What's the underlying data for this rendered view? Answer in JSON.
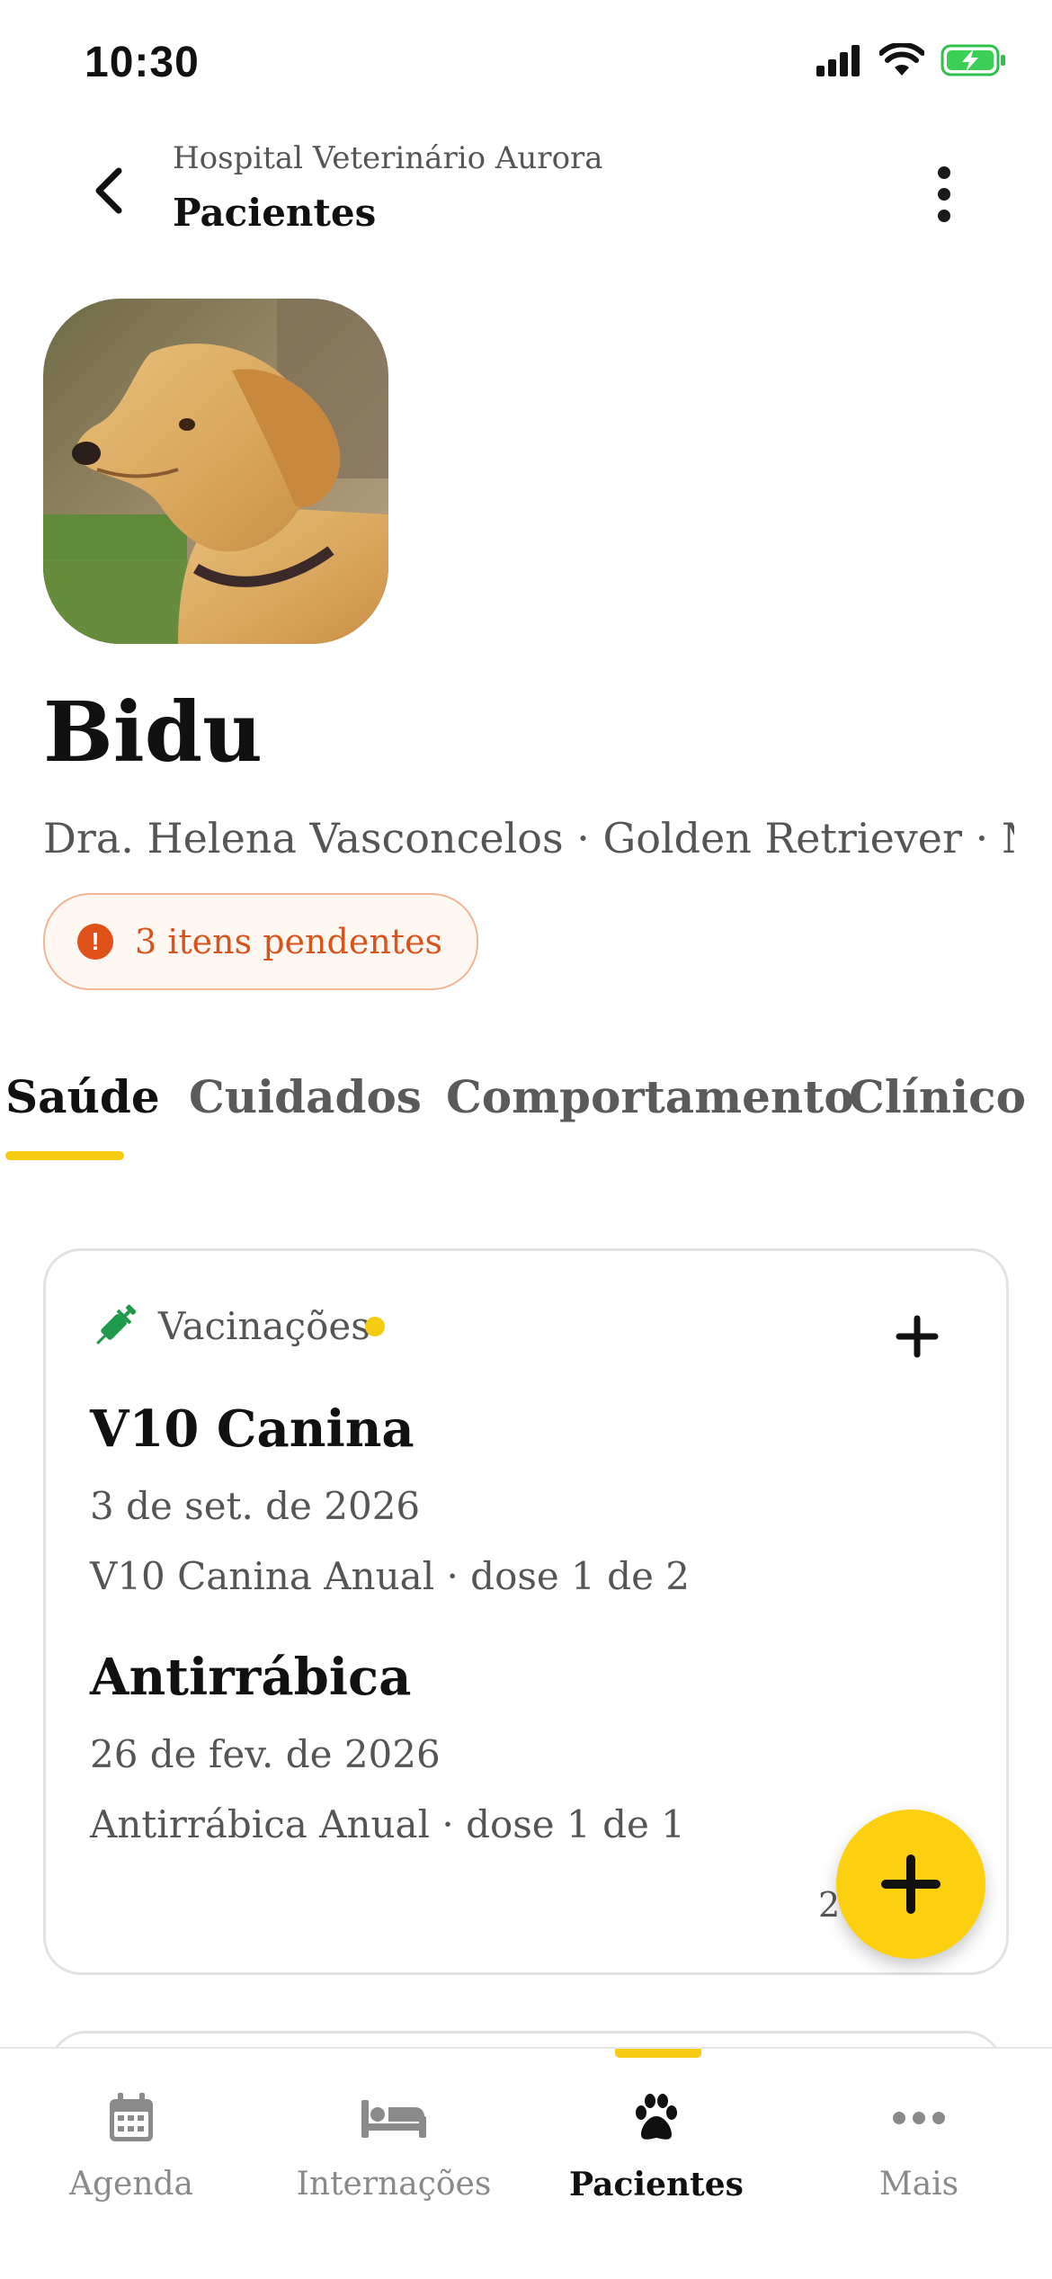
{
  "status_bar": {
    "time": "10:30"
  },
  "header": {
    "subtitle": "Hospital Veterinário Aurora",
    "title": "Pacientes"
  },
  "patient": {
    "name": "Bidu",
    "meta": "Dra. Helena Vasconcelos · Golden Retriever · Ma...",
    "pending_label": "3 itens pendentes"
  },
  "tabs": [
    {
      "label": "Saúde",
      "active": true
    },
    {
      "label": "Cuidados",
      "active": false
    },
    {
      "label": "Comportamento",
      "active": false
    },
    {
      "label": "Clínico",
      "active": false
    }
  ],
  "vaccinations_card": {
    "title": "Vacinações",
    "items": [
      {
        "name": "V10 Canina",
        "date": "3 de set. de 2026",
        "detail": "V10 Canina Anual · dose 1 de 2"
      },
      {
        "name": "Antirrábica",
        "date": "26 de fev. de 2026",
        "detail": "Antirrábica Anual · dose 1 de 1"
      }
    ],
    "count_fragment": "2"
  },
  "bottom_nav": [
    {
      "label": "Agenda",
      "icon": "calendar-icon",
      "active": false
    },
    {
      "label": "Internações",
      "icon": "bed-icon",
      "active": false
    },
    {
      "label": "Pacientes",
      "icon": "paw-icon",
      "active": true
    },
    {
      "label": "Mais",
      "icon": "more-icon",
      "active": false
    }
  ],
  "colors": {
    "accent": "#fcd00f",
    "warning": "#e0511a",
    "vaccine_icon": "#1f9a4a"
  }
}
